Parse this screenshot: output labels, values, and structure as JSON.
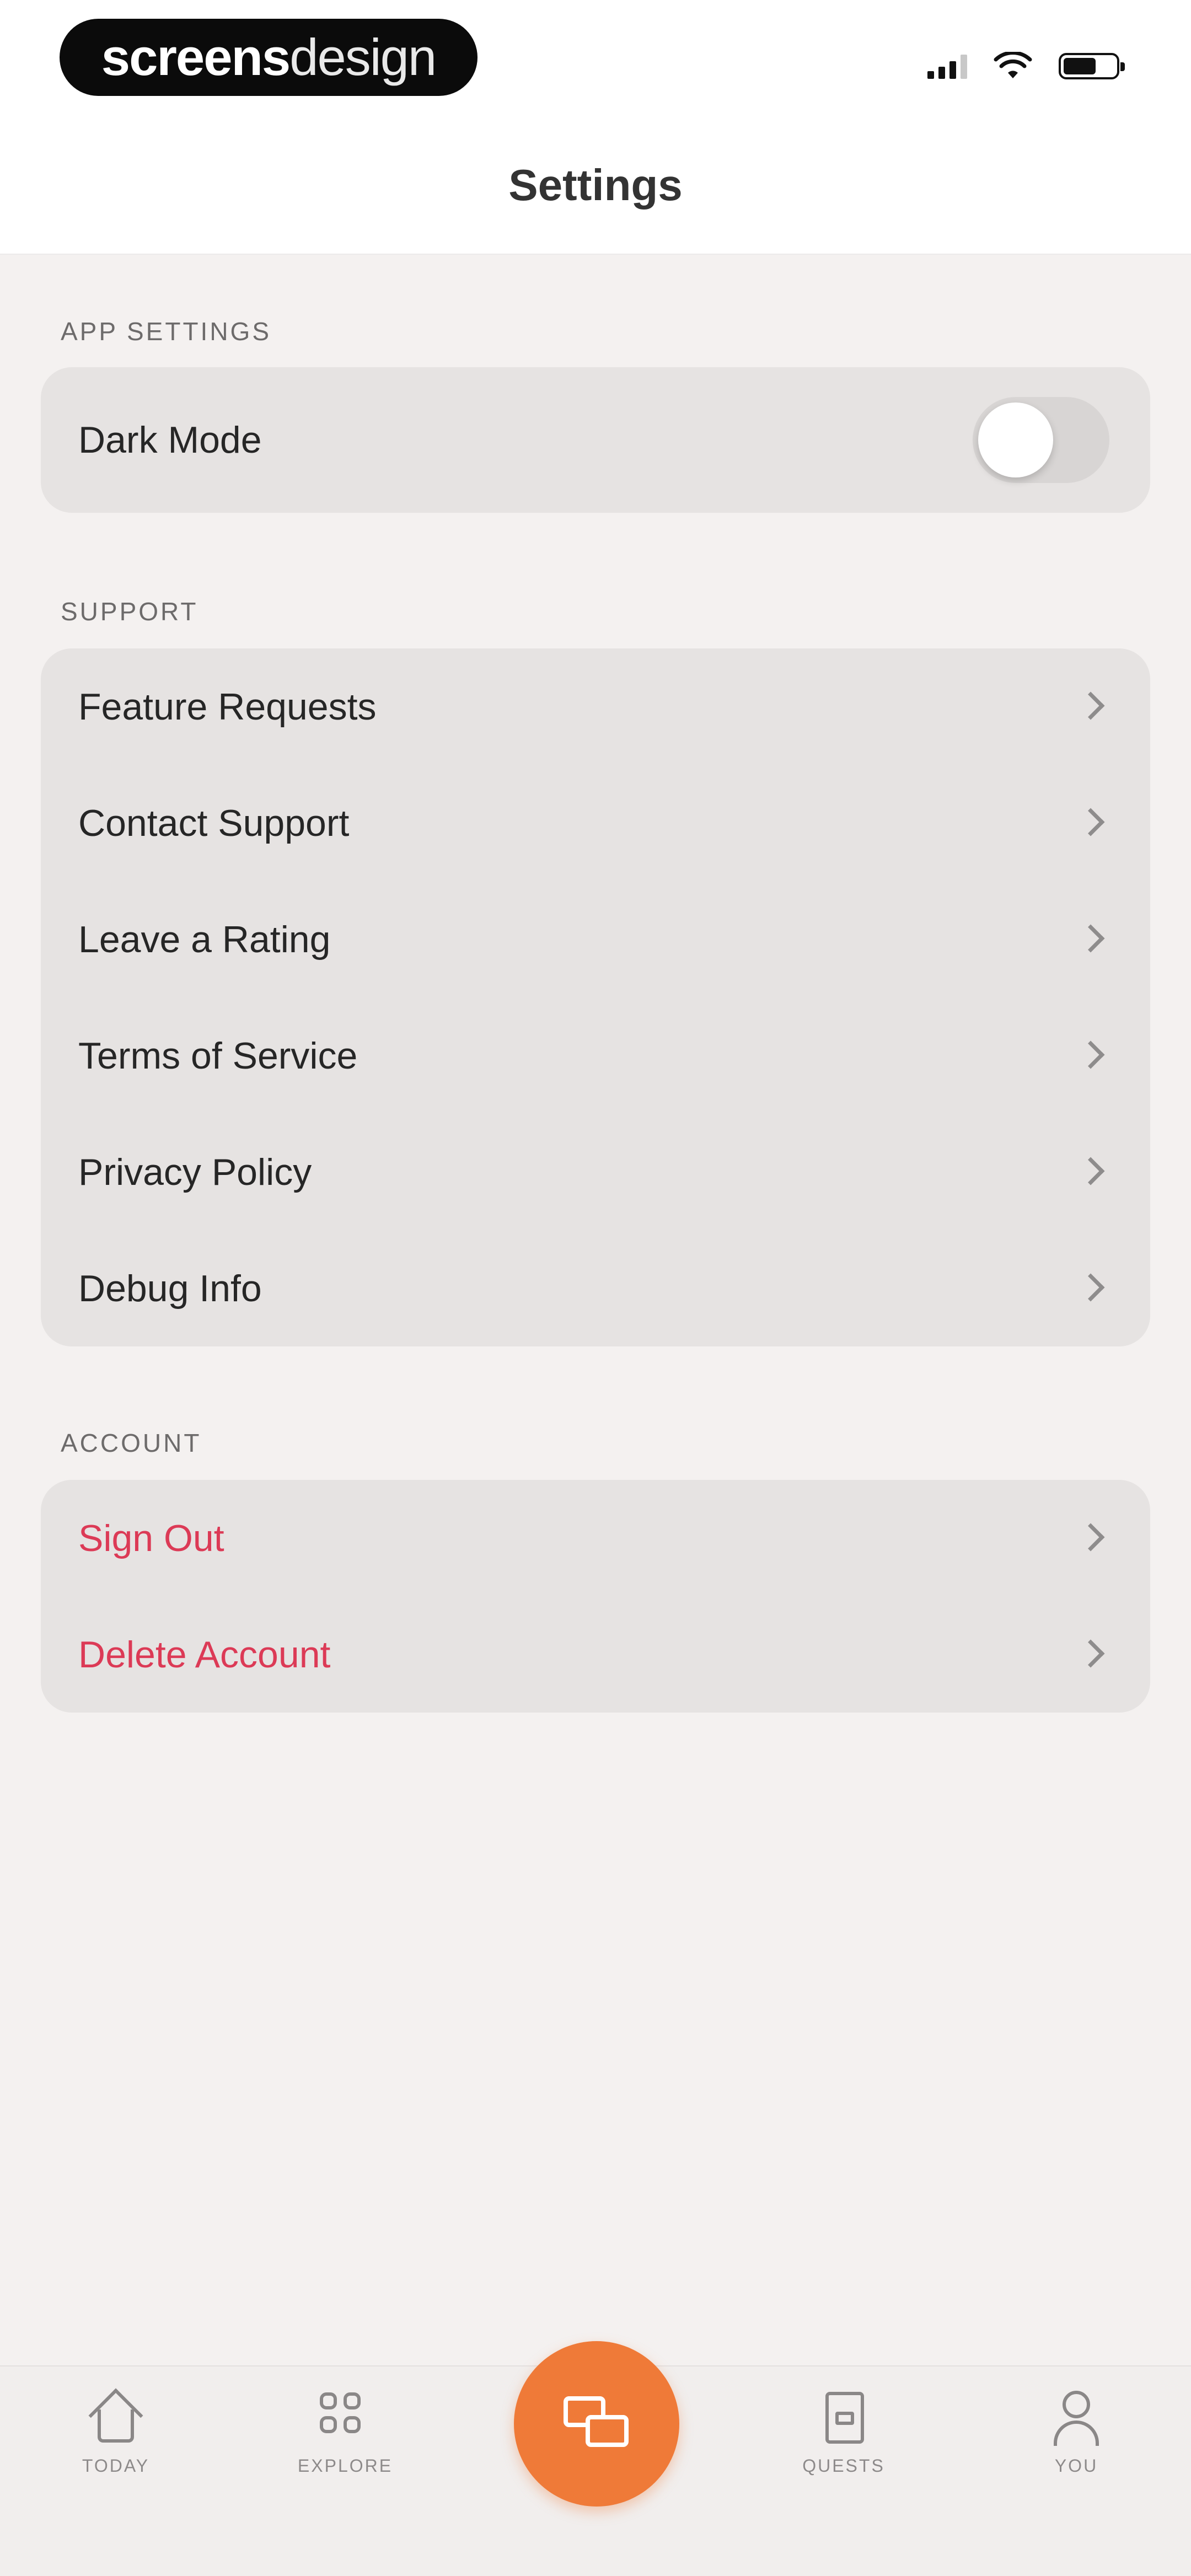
{
  "status_bar": {
    "brand_bold": "screens",
    "brand_light": "design"
  },
  "header": {
    "title": "Settings"
  },
  "sections": {
    "app_settings": {
      "label": "APP SETTINGS",
      "dark_mode": {
        "label": "Dark Mode",
        "enabled": false
      }
    },
    "support": {
      "label": "SUPPORT",
      "items": [
        {
          "label": "Feature Requests"
        },
        {
          "label": "Contact Support"
        },
        {
          "label": "Leave a Rating"
        },
        {
          "label": "Terms of Service"
        },
        {
          "label": "Privacy Policy"
        },
        {
          "label": "Debug Info"
        }
      ]
    },
    "account": {
      "label": "ACCOUNT",
      "items": [
        {
          "label": "Sign Out"
        },
        {
          "label": "Delete Account"
        }
      ]
    }
  },
  "tabbar": {
    "tabs": [
      {
        "label": "TODAY",
        "icon": "home-icon"
      },
      {
        "label": "EXPLORE",
        "icon": "grid-icon"
      },
      {
        "label": "QUESTS",
        "icon": "scroll-icon"
      },
      {
        "label": "YOU",
        "icon": "person-icon"
      }
    ],
    "center_action_icon": "chat-icon"
  },
  "colors": {
    "accent": "#ef7a38",
    "danger": "#dc3a56",
    "background": "#f4f1f0",
    "card": "#e6e3e2"
  }
}
